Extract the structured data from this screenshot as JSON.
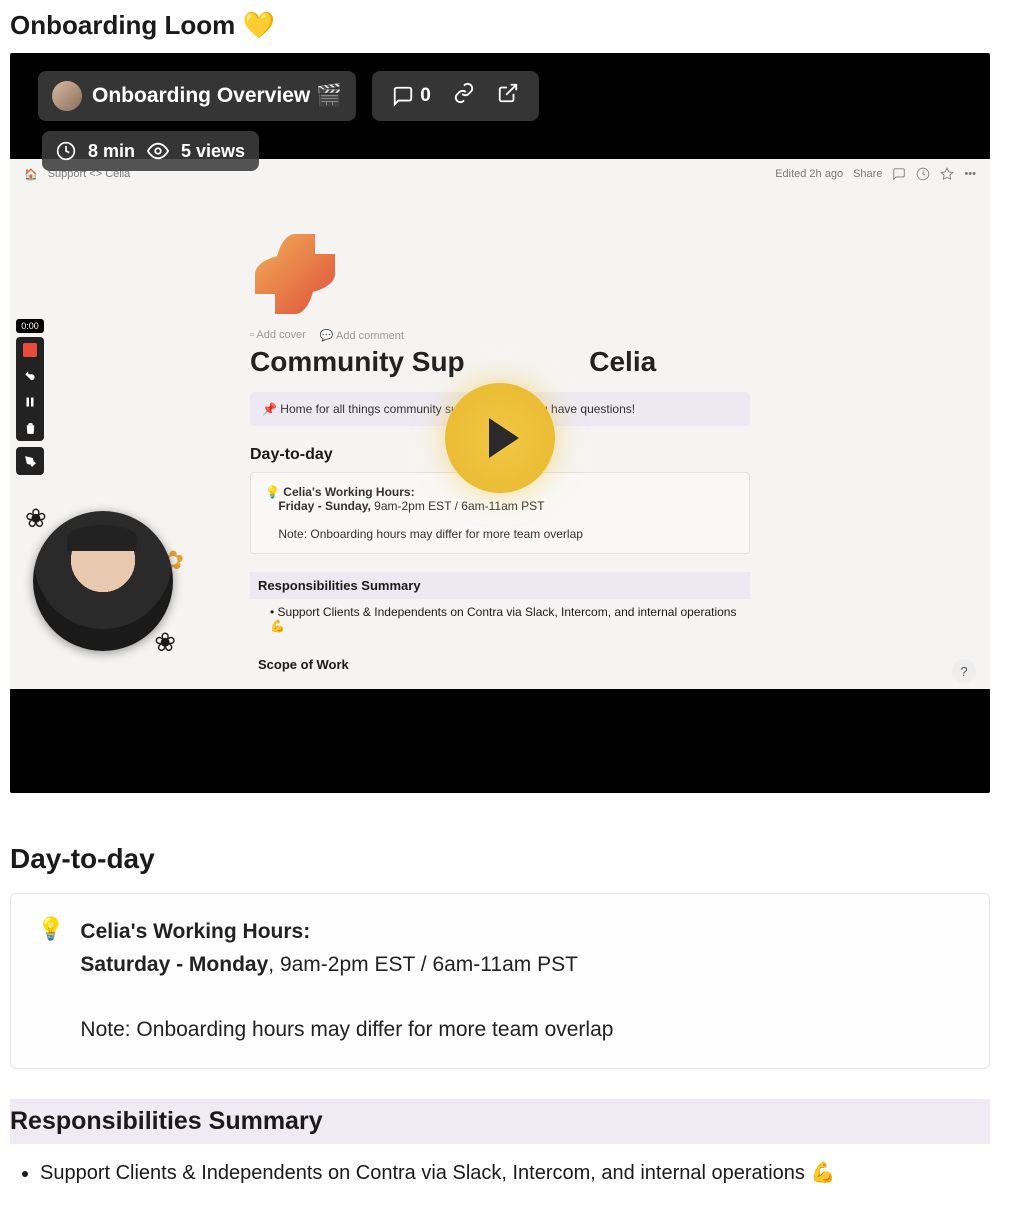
{
  "page_title": "Onboarding Loom 💛",
  "video": {
    "title": "Onboarding Overview 🎬",
    "comment_count": "0",
    "duration": "8 min",
    "views": "5 views",
    "timestamp": "0:00"
  },
  "notion_preview": {
    "breadcrumb": "Support <> Celia",
    "edited": "Edited 2h ago",
    "share": "Share",
    "add_cover": "Add cover",
    "add_comment": "Add comment",
    "title_left": "Community Sup",
    "title_right": "Celia",
    "callout": "📌 Home for all things community sup                       via Slack if you have questions!",
    "h2_daytoday": "Day-to-day",
    "hours_label": "Celia's Working Hours:",
    "hours_days_bold": "Friday - Sunday,",
    "hours_rest": " 9am-2pm EST / 6am-11am PST",
    "hours_note": "Note: Onboarding hours may differ for more team overlap",
    "resp_head": "Responsibilities Summary",
    "resp_item": "Support Clients & Independents on Contra via Slack, Intercom, and internal operations 💪",
    "scope_head": "Scope of Work"
  },
  "day_to_day": {
    "heading": "Day-to-day",
    "hours_label": "Celia's Working Hours:",
    "hours_days_bold": "Saturday - Monday",
    "hours_rest": ", 9am-2pm EST / 6am-11am PST",
    "note": "Note: Onboarding hours may differ for more team overlap"
  },
  "responsibilities": {
    "heading": "Responsibilities Summary",
    "items": [
      "Support Clients & Independents on Contra via Slack, Intercom, and internal operations 💪"
    ]
  }
}
